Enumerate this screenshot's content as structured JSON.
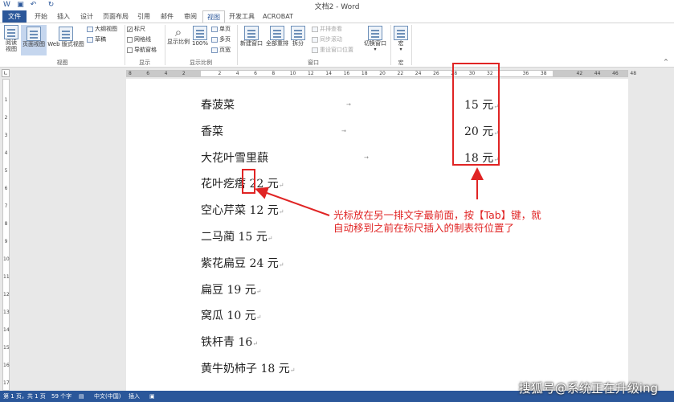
{
  "title_bar": {
    "doc_title": "文档2 - Word"
  },
  "tabs": [
    "文件",
    "开始",
    "插入",
    "设计",
    "页面布局",
    "引用",
    "邮件",
    "审阅",
    "视图",
    "开发工具",
    "ACROBAT"
  ],
  "ribbon": {
    "views": {
      "read": "阅读\n视图",
      "print": "页面视图",
      "web": "Web 版式视图",
      "outline": "大纲视图",
      "draft": "草稿",
      "group": "视图"
    },
    "show": {
      "ruler": "标尺",
      "gridlines": "网格线",
      "nav": "导航窗格",
      "group": "显示"
    },
    "zoom": {
      "zoom": "显示比例",
      "percent": "100%",
      "one_page": "单页",
      "multi_page": "多页",
      "page_width": "页宽",
      "group": "显示比例"
    },
    "window": {
      "new": "新建窗口",
      "arrange": "全部重排",
      "split": "拆分",
      "side_by_side": "并排查看",
      "sync": "同步滚动",
      "reset": "重设窗口位置",
      "switch": "切换窗口",
      "group": "窗口"
    },
    "macros": {
      "macro": "宏",
      "group": "宏"
    }
  },
  "ruler": {
    "numbers": [
      "8",
      "6",
      "4",
      "2",
      "",
      "2",
      "4",
      "6",
      "8",
      "10",
      "12",
      "14",
      "16",
      "18",
      "20",
      "22",
      "24",
      "26",
      "28",
      "30",
      "32",
      "",
      "36",
      "38",
      "",
      "42",
      "44",
      "46",
      "48"
    ]
  },
  "vruler": [
    "1",
    "2",
    "3",
    "4",
    "5",
    "6",
    "7",
    "8",
    "9",
    "10",
    "11",
    "12",
    "13",
    "14",
    "15",
    "16",
    "17"
  ],
  "document": {
    "lines": [
      "春菠菜",
      "香菜",
      "大花叶雪里蕻",
      "花叶疙瘩 22 元",
      "空心芹菜 12 元",
      "二马蔺 15 元",
      "紫花扁豆 24 元",
      "扁豆 19 元",
      "窝瓜 10 元",
      "铁杆青 16",
      "黄牛奶柿子 18 元"
    ],
    "right_values": [
      "15 元",
      "20 元",
      "18 元"
    ]
  },
  "annotation": "光标放在另一排文字最前面，按【Tab】键，就自动移到之前在标尺插入的制表符位置了",
  "status": {
    "page": "第 1 页，共 1 页",
    "words": "59 个字",
    "lang": "中文(中国)",
    "mode": "插入"
  },
  "watermark": "搜狐号@系统正在升级ing",
  "colors": {
    "accent": "#2b579a",
    "annotation": "#e02424"
  }
}
